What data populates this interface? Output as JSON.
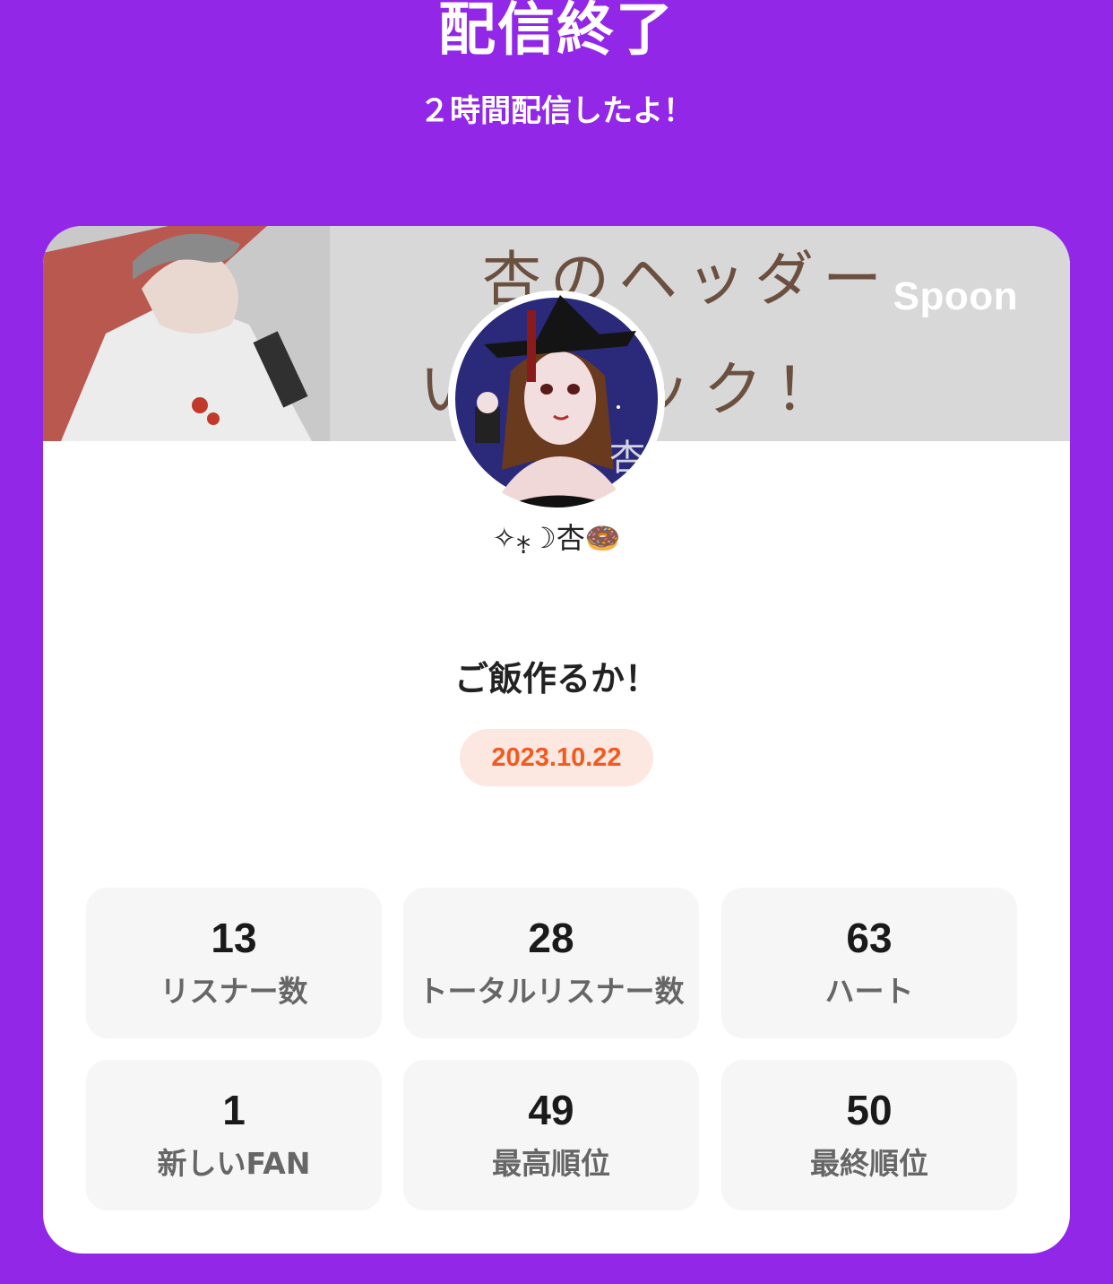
{
  "header": {
    "title": "配信終了",
    "subtitle": "２時間配信したよ！"
  },
  "card": {
    "banner_logo": "Spoon",
    "banner_text": [
      "杏のヘッダー",
      "いジャック！"
    ],
    "avatar_icon": "user-avatar",
    "username": "✧⁎̣☽杏🍩",
    "stream_title": "ご飯作るか！",
    "date": "2023.10.22"
  },
  "stats": [
    {
      "value": "13",
      "label": "リスナー数"
    },
    {
      "value": "28",
      "label": "トータルリスナー数"
    },
    {
      "value": "63",
      "label": "ハート"
    },
    {
      "value": "1",
      "label": "新しいFAN"
    },
    {
      "value": "49",
      "label": "最高順位"
    },
    {
      "value": "50",
      "label": "最終順位"
    }
  ],
  "colors": {
    "background": "#9327e8",
    "card": "#ffffff",
    "date_text": "#f25a1f",
    "date_bg": "#fde7e1",
    "stat_bg": "#f6f6f6"
  }
}
